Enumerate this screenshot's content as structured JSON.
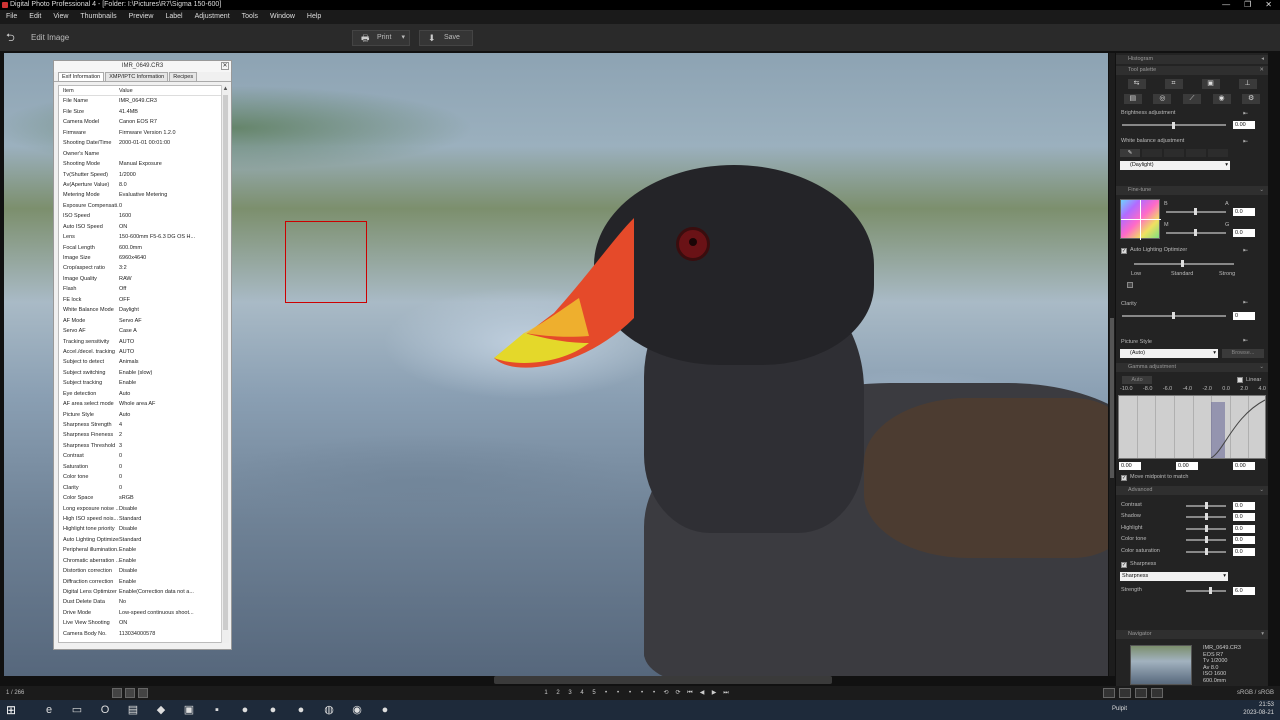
{
  "window": {
    "title": "Digital Photo Professional 4 - [Folder: I:\\Pictures\\R7\\Sigma 150-600]"
  },
  "menu": [
    "File",
    "Edit",
    "View",
    "Thumbnails",
    "Preview",
    "Label",
    "Adjustment",
    "Tools",
    "Window",
    "Help"
  ],
  "toolbar": {
    "edit_label": "Edit Image",
    "print_label": "Print",
    "save_label": "Save"
  },
  "exif_panel": {
    "title": "IMR_0649.CR3",
    "tabs": [
      "Exif Information",
      "XMP/IPTC Information",
      "Recipes"
    ],
    "header": {
      "item": "Item",
      "value": "Value"
    },
    "rows": [
      [
        "File Name",
        "IMR_0649.CR3"
      ],
      [
        "File Size",
        "41.4MB"
      ],
      [
        "Camera Model",
        "Canon EOS R7"
      ],
      [
        "Firmware",
        "Firmware Version 1.2.0"
      ],
      [
        "Shooting Date/Time",
        "2000-01-01 00:01:00"
      ],
      [
        "Owner's Name",
        ""
      ],
      [
        "Shooting Mode",
        "Manual Exposure"
      ],
      [
        "Tv(Shutter Speed)",
        "1/2000"
      ],
      [
        "Av(Aperture Value)",
        "8.0"
      ],
      [
        "Metering Mode",
        "Evaluative Metering"
      ],
      [
        "Exposure Compensati...",
        "0"
      ],
      [
        "ISO Speed",
        "1600"
      ],
      [
        "Auto ISO Speed",
        "ON"
      ],
      [
        "Lens",
        "150-600mm F5-6.3 DG OS H..."
      ],
      [
        "Focal Length",
        "600.0mm"
      ],
      [
        "Image Size",
        "6960x4640"
      ],
      [
        "Crop/aspect ratio",
        "3:2"
      ],
      [
        "Image Quality",
        "RAW"
      ],
      [
        "Flash",
        "Off"
      ],
      [
        "FE lock",
        "OFF"
      ],
      [
        "White Balance Mode",
        "Daylight"
      ],
      [
        "AF Mode",
        "Servo AF"
      ],
      [
        "Servo AF",
        "Case A"
      ],
      [
        "Tracking sensitivity",
        "AUTO"
      ],
      [
        "Accel./decel. tracking",
        "AUTO"
      ],
      [
        "Subject to detect",
        "Animals"
      ],
      [
        "Subject switching",
        "Enable (slow)"
      ],
      [
        "Subject tracking",
        "Enable"
      ],
      [
        "Eye detection",
        "Auto"
      ],
      [
        "AF area select mode",
        "Whole area AF"
      ],
      [
        "Picture Style",
        "Auto"
      ],
      [
        "Sharpness Strength",
        "4"
      ],
      [
        "Sharpness Fineness",
        "2"
      ],
      [
        "Sharpness Threshold",
        "3"
      ],
      [
        "Contrast",
        "0"
      ],
      [
        "Saturation",
        "0"
      ],
      [
        "Color tone",
        "0"
      ],
      [
        "Clarity",
        "0"
      ],
      [
        "Color Space",
        "sRGB"
      ],
      [
        "Long exposure noise ...",
        "Disable"
      ],
      [
        "High ISO speed nois...",
        "Standard"
      ],
      [
        "Highlight tone priority",
        "Disable"
      ],
      [
        "Auto Lighting Optimizer",
        "Standard"
      ],
      [
        "Peripheral illumination...",
        "Enable"
      ],
      [
        "Chromatic aberration ...",
        "Enable"
      ],
      [
        "Distortion correction",
        "Disable"
      ],
      [
        "Diffraction correction",
        "Enable"
      ],
      [
        "Digital Lens Optimizer",
        "Enable(Correction data not a..."
      ],
      [
        "Dust Delete Data",
        "No"
      ],
      [
        "Drive Mode",
        "Low-speed continuous shoot..."
      ],
      [
        "Live View Shooting",
        "ON"
      ],
      [
        "Camera Body No.",
        "113034000578"
      ]
    ]
  },
  "right_panel": {
    "histogram": "Histogram",
    "tool_palette": "Tool palette",
    "brightness_label": "Brightness adjustment",
    "brightness_value": "0.00",
    "white_balance_label": "White balance adjustment",
    "white_balance_value": "(Daylight)",
    "fine_tune_label": "Fine-tune",
    "ft_b": "B",
    "ft_a": "A",
    "ft_m": "M",
    "ft_g": "G",
    "ft_a_value": "0.0",
    "ft_g_value": "0.0",
    "alo_label": "Auto Lighting Optimizer",
    "alo_low": "Low",
    "alo_standard": "Standard",
    "alo_strong": "Strong",
    "clarity_label": "Clarity",
    "clarity_value": "0",
    "picture_style_label": "Picture Style",
    "picture_style_value": "(Auto)",
    "browse_label": "Browse...",
    "gamma_label": "Gamma adjustment",
    "auto_label": "Auto",
    "linear_label": "Linear",
    "gamma_ticks": [
      "-10.0",
      "-8.0",
      "-6.0",
      "-4.0",
      "-2.0",
      "0.0",
      "2.0",
      "4.0"
    ],
    "gamma_values": [
      "0.00",
      "0.00",
      "0.00"
    ],
    "move_midpoint_label": "Move midpoint to match",
    "advanced_label": "Advanced",
    "advanced": [
      {
        "label": "Contrast",
        "value": "0.0"
      },
      {
        "label": "Shadow",
        "value": "0.0"
      },
      {
        "label": "Highlight",
        "value": "0.0"
      },
      {
        "label": "Color tone",
        "value": "0.0"
      },
      {
        "label": "Color saturation",
        "value": "0.0"
      }
    ],
    "sharpness_check_label": "Sharpness",
    "sharpness_value": "Sharpness",
    "strength_label": "Strength",
    "strength_value": "6.0",
    "navigator_label": "Navigator",
    "nav_info": [
      "IMR_0649.CR3",
      "EOS R7",
      "Tv 1/2000",
      "Av 8.0",
      "ISO 1600",
      "600.0mm"
    ]
  },
  "status": {
    "count": "1 / 266",
    "color_space": "sRGB / sRGB",
    "star_labels": [
      "1",
      "2",
      "3",
      "4",
      "5"
    ]
  },
  "taskbar": {
    "tray_label": "Pulpit",
    "time": "21:53",
    "date": "2023-08-21"
  }
}
